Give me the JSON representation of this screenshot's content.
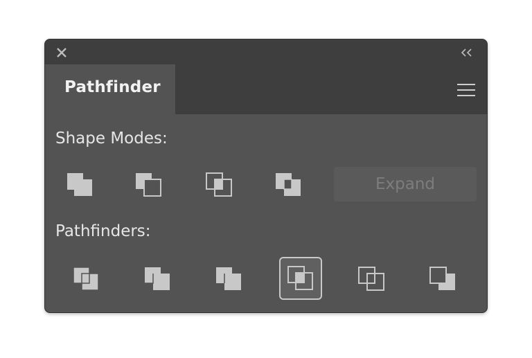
{
  "panel": {
    "tab_label": "Pathfinder",
    "icons": {
      "close": "close-icon",
      "collapse": "double-chevron-left-icon",
      "menu": "hamburger-menu-icon"
    }
  },
  "shape_modes": {
    "label": "Shape Modes:",
    "buttons": [
      {
        "icon": "unite-icon"
      },
      {
        "icon": "minus-front-icon"
      },
      {
        "icon": "intersect-icon"
      },
      {
        "icon": "exclude-icon"
      }
    ],
    "expand_label": "Expand",
    "expand_enabled": false
  },
  "pathfinders": {
    "label": "Pathfinders:",
    "buttons": [
      {
        "icon": "divide-icon"
      },
      {
        "icon": "trim-icon"
      },
      {
        "icon": "merge-icon"
      },
      {
        "icon": "crop-icon",
        "selected": true
      },
      {
        "icon": "outline-icon"
      },
      {
        "icon": "minus-back-icon"
      }
    ]
  },
  "colors": {
    "panel_bg": "#535353",
    "header_bg": "#3e3e3e",
    "icon_fill": "#c8c8c8",
    "disabled_text": "#7d7d7d"
  }
}
